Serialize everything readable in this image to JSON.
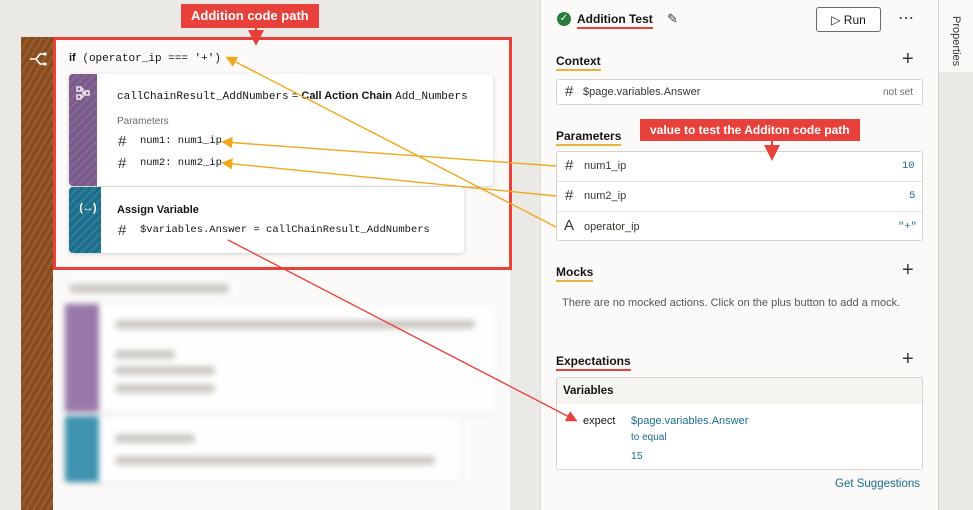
{
  "callouts": {
    "top": "Addition code path",
    "middle": "value to test the Additon code path"
  },
  "flow": {
    "if_keyword": "if",
    "if_condition": "(operator_ip === '+')",
    "call_action": {
      "result_var": "callChainResult_AddNumbers",
      "equals": "=",
      "action_label": "Call Action Chain",
      "chain_name": "Add_Numbers",
      "parameters_label": "Parameters",
      "params": [
        "num1: num1_ip",
        "num2: num2_ip"
      ]
    },
    "assign": {
      "title": "Assign Variable",
      "expression": "$variables.Answer = callChainResult_AddNumbers"
    }
  },
  "test": {
    "title": "Addition Test",
    "run_label": "Run",
    "more_label": "⋯",
    "context": {
      "title": "Context",
      "variable": "$page.variables.Answer",
      "status": "not set"
    },
    "parameters": {
      "title": "Parameters",
      "items": [
        {
          "name": "num1_ip",
          "value": "10"
        },
        {
          "name": "num2_ip",
          "value": "5"
        },
        {
          "name": "operator_ip",
          "value": "\"+\""
        }
      ]
    },
    "mocks": {
      "title": "Mocks",
      "empty_text": "There are no mocked actions. Click on the plus button to add a mock."
    },
    "expectations": {
      "title": "Expectations",
      "group": "Variables",
      "expect_label": "expect",
      "variable": "$page.variables.Answer",
      "matcher": "to equal",
      "value": "15"
    },
    "get_suggestions": "Get Suggestions"
  },
  "side_tab": {
    "label": "Properties"
  },
  "colors": {
    "accent_red": "#e8413b",
    "accent_yellow": "#e8b33b",
    "link_blue": "#1a6e8c",
    "success_green": "#2a7d3f"
  }
}
